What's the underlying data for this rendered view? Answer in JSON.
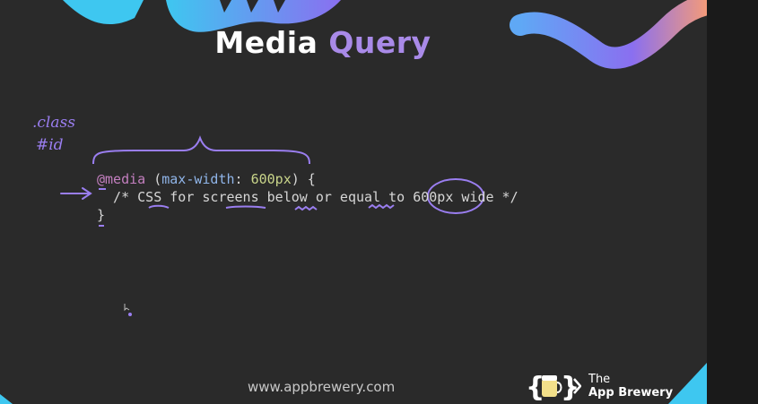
{
  "title": {
    "word1": "Media",
    "word2": "Query"
  },
  "handwritten_notes": {
    "line1": ".class",
    "line2": "#id"
  },
  "code": {
    "line1": {
      "keyword": "@media",
      "open_paren": "(",
      "property": "max-width",
      "colon": ":",
      "value": "600px",
      "close": ") {"
    },
    "line2": "  /* CSS for screens below or equal to 600px wide */",
    "line3": "}"
  },
  "footer": {
    "url": "www.appbrewery.com",
    "brand_the": "The",
    "brand_name": "App Brewery"
  },
  "colors": {
    "background": "#2a2a2a",
    "title_accent": "#a98ae8",
    "annotation_ink": "#9a7ef0",
    "code_keyword": "#c37fbf",
    "code_property": "#8fb4e8",
    "code_number": "#c9d58a",
    "deco_cyan": "#3ec7f0",
    "deco_purple": "#8a6ff0"
  },
  "icons": {
    "brand_logo": "curly-braces-mug-icon",
    "cursor": "cursor-icon"
  }
}
